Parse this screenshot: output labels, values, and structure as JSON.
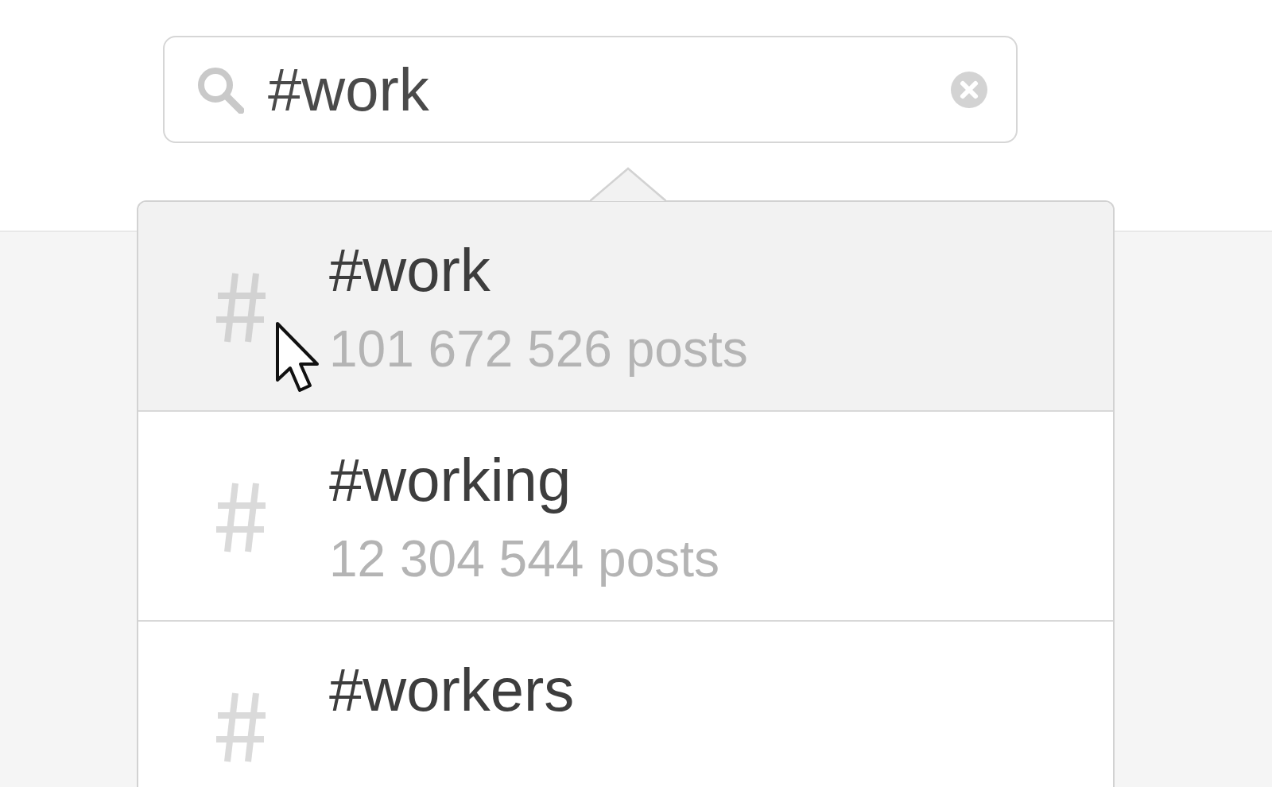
{
  "search": {
    "value": "#work"
  },
  "suggestions": [
    {
      "tag": "#work",
      "count": "101 672 526 posts",
      "selected": true
    },
    {
      "tag": "#working",
      "count": "12 304 544 posts",
      "selected": false
    },
    {
      "tag": "#workers",
      "selected": false
    }
  ]
}
